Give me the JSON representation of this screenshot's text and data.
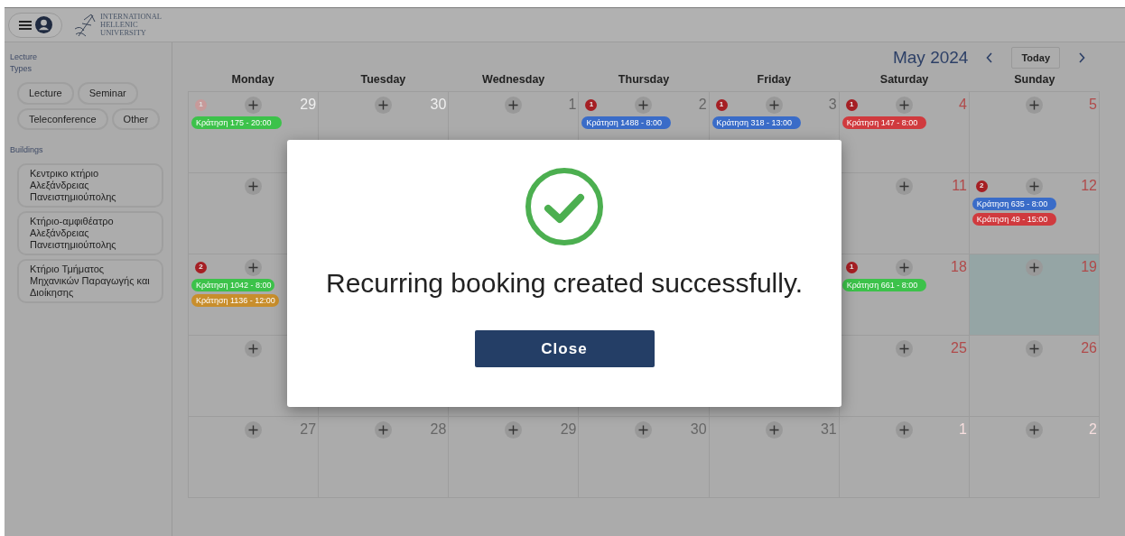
{
  "header": {
    "logo_lines": [
      "INTERNATIONAL",
      "HELLENIC",
      "UNIVERSITY"
    ]
  },
  "sidebar": {
    "lecture_types_label": "Lecture Types",
    "lecture_types": [
      "Lecture",
      "Seminar",
      "Teleconference",
      "Other"
    ],
    "buildings_label": "Buildings",
    "buildings": [
      "Κεντρικο κτήριο Αλεξάνδρειας Πανειστημιούπολης",
      "Κτήριο-αμφιθέατρο Αλεξάνδρειας Πανειστημιούπολης",
      "Κτήριο Τμήματος Μηχανικών Παραγωγής και Διοίκησης"
    ]
  },
  "calendar": {
    "title": "May 2024",
    "today_button": "Today",
    "columns": [
      {
        "label": "Monday",
        "weekend": false
      },
      {
        "label": "Tuesday",
        "weekend": false
      },
      {
        "label": "Wednesday",
        "weekend": false
      },
      {
        "label": "Thursday",
        "weekend": false
      },
      {
        "label": "Friday",
        "weekend": false
      },
      {
        "label": "Saturday",
        "weekend": true
      },
      {
        "label": "Sunday",
        "weekend": true
      }
    ],
    "weeks": [
      {
        "left": [
          {
            "day": "29",
            "other_month": true,
            "add": true,
            "badge": "1",
            "events": [
              {
                "label": "Κράτηση 175 - 20:00",
                "color": "#3cc24a"
              }
            ]
          },
          {
            "day": "30",
            "other_month": true,
            "add": true
          },
          {
            "day": "1",
            "other_month": false,
            "add": true
          },
          {
            "day": "2",
            "other_month": false,
            "add": true,
            "badge": "1",
            "events": [
              {
                "label": "Κράτηση 1488 - 8:00",
                "color": "#3a6cc8"
              }
            ]
          },
          {
            "day": "3",
            "other_month": false,
            "add": true,
            "badge": "1",
            "events": [
              {
                "label": "Κράτηση 318 - 13:00",
                "color": "#3a6cc8"
              }
            ]
          },
          {
            "day": "4",
            "other_month": false,
            "add": true,
            "badge": "1",
            "events": [
              {
                "label": "Κράτηση 147 - 8:00",
                "color": "#d03a3e"
              }
            ]
          },
          {
            "day": "5",
            "other_month": false,
            "add": true
          }
        ]
      },
      {
        "left": [
          {
            "add": true
          }
        ],
        "right": [
          {
            "day": "11",
            "other_month": false,
            "add": true
          },
          {
            "day": "12",
            "other_month": false,
            "add": true,
            "badge": "2",
            "events": [
              {
                "label": "Κράτηση 635 - 8:00",
                "color": "#3a6cc8"
              },
              {
                "label": "Κράτηση 49 - 15:00",
                "color": "#d03a3e"
              }
            ]
          }
        ]
      },
      {
        "left": [
          {
            "add": true,
            "badge": "2",
            "events": [
              {
                "label": "Κράτηση 1042 - 8:00",
                "color": "#3cc24a"
              },
              {
                "label": "Κράτηση 1136 - 12:00",
                "color": "#c88e2c"
              }
            ]
          }
        ],
        "right": [
          {
            "day": "18",
            "other_month": false,
            "add": true,
            "badge": "1",
            "events": [
              {
                "label": "Κράτηση 661 - 8:00",
                "color": "#3cc24a"
              }
            ]
          },
          {
            "day": "19",
            "other_month": false,
            "add": true,
            "today": true
          }
        ]
      },
      {
        "left": [
          {
            "add": true
          }
        ],
        "right": [
          {
            "day": "25",
            "other_month": false,
            "add": true
          },
          {
            "day": "26",
            "other_month": false,
            "add": true
          }
        ]
      },
      {
        "left": [
          {
            "day": "27",
            "other_month": false,
            "add": true
          },
          {
            "day": "28",
            "other_month": false,
            "add": true
          },
          {
            "day": "29",
            "other_month": false,
            "add": true
          },
          {
            "day": "30",
            "other_month": false,
            "add": true
          },
          {
            "day": "31",
            "other_month": false,
            "add": true
          },
          {
            "day": "1",
            "other_month": true,
            "add": true
          },
          {
            "day": "2",
            "other_month": true,
            "add": true
          }
        ]
      }
    ]
  },
  "dialog": {
    "message": "Recurring booking created successfully.",
    "button": "Close"
  }
}
